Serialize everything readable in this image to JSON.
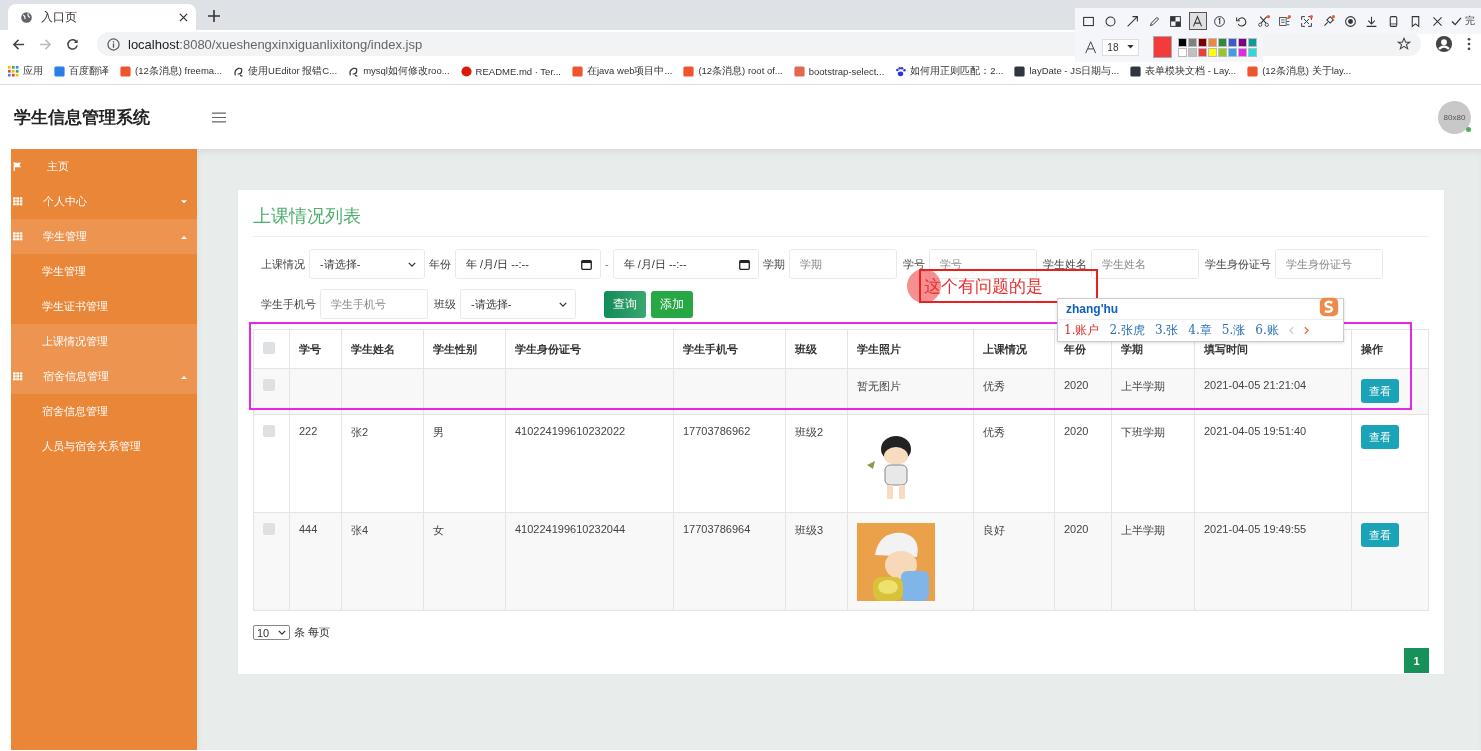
{
  "browser": {
    "tab_title": "入口页",
    "url_host": "localhost",
    "url_rest": ":8080/xueshengxinxiguanlixitong/index.jsp",
    "bookmarks": [
      {
        "label": "应用",
        "kind": "apps"
      },
      {
        "label": "百度翻译",
        "kind": "square",
        "color": "#2a7ee8"
      },
      {
        "label": "(12条消息) freema...",
        "kind": "square",
        "color": "#f0542c"
      },
      {
        "label": "使用UEditor 报错C...",
        "kind": "swirl"
      },
      {
        "label": "mysql如何修改roo...",
        "kind": "swirl"
      },
      {
        "label": "README.md · Ter...",
        "kind": "circle",
        "color": "#d81e06"
      },
      {
        "label": "在java web项目中...",
        "kind": "square",
        "color": "#f0542c"
      },
      {
        "label": "(12条消息) root of...",
        "kind": "square",
        "color": "#f0542c"
      },
      {
        "label": "bootstrap-select...",
        "kind": "square",
        "color": "#e2694f"
      },
      {
        "label": "如何用正则匹配：2...",
        "kind": "paw",
        "color": "#2932e1"
      },
      {
        "label": "layDate - JS日期与...",
        "kind": "square",
        "color": "#2f3640"
      },
      {
        "label": "表单模块文档 - Lay...",
        "kind": "square",
        "color": "#2f3640"
      },
      {
        "label": "(12条消息) 关于lay...",
        "kind": "square",
        "color": "#f0542c"
      }
    ]
  },
  "capture_toolbar": {
    "tools": [
      {
        "kind": "rectangle",
        "selected": false,
        "badge_dot": false
      },
      {
        "kind": "ellipse",
        "selected": false,
        "badge_dot": false
      },
      {
        "kind": "arrow",
        "selected": false,
        "badge_dot": false
      },
      {
        "kind": "pencil",
        "selected": false,
        "badge_dot": false
      },
      {
        "kind": "mosaic",
        "selected": false,
        "badge_dot": false
      },
      {
        "kind": "text",
        "selected": true,
        "badge_dot": false
      },
      {
        "kind": "number",
        "selected": false,
        "badge_dot": false
      },
      {
        "kind": "undo",
        "selected": false,
        "badge_dot": false
      },
      {
        "kind": "cut",
        "selected": false,
        "badge_dot": true
      },
      {
        "kind": "ocr",
        "selected": false,
        "badge_dot": true
      },
      {
        "kind": "capture",
        "selected": false,
        "badge_dot": true
      },
      {
        "kind": "pin",
        "selected": false,
        "badge_dot": true
      },
      {
        "kind": "record",
        "selected": false,
        "badge_dot": false
      },
      {
        "kind": "download",
        "selected": false,
        "badge_dot": false
      },
      {
        "kind": "phone",
        "selected": false,
        "badge_dot": false
      },
      {
        "kind": "bookmark",
        "selected": false,
        "badge_dot": false
      },
      {
        "kind": "close",
        "selected": false,
        "badge_dot": false
      }
    ],
    "done_label": "完",
    "font_size": "18",
    "swatches": [
      {
        "color": "#000000"
      },
      {
        "color": "#808080"
      },
      {
        "color": "#800000"
      },
      {
        "color": "#f0883c"
      },
      {
        "color": "#2e8b3c"
      },
      {
        "color": "#3c5ad0"
      },
      {
        "color": "#800080"
      },
      {
        "color": "#0f9a9a"
      },
      {
        "color": "#ffffff"
      },
      {
        "color": "#c0c0c0"
      },
      {
        "color": "#f03c3c"
      },
      {
        "color": "#ffff00"
      },
      {
        "color": "#96c81e"
      },
      {
        "color": "#3ca0e6"
      },
      {
        "color": "#e628e6"
      },
      {
        "color": "#28dcdc"
      }
    ]
  },
  "app": {
    "title": "学生信息管理系统",
    "avatar_label": "80x80"
  },
  "sidebar": {
    "items": [
      {
        "label": "主页",
        "kind": "flag",
        "selected": false
      },
      {
        "label": "个人中心",
        "kind": "grid",
        "selected": false,
        "expanded": false
      },
      {
        "label": "学生管理",
        "kind": "grid",
        "selected": false,
        "expanded": true,
        "children": [
          {
            "label": "学生管理",
            "selected": false
          },
          {
            "label": "学生证书管理",
            "selected": false
          },
          {
            "label": "上课情况管理",
            "selected": true
          }
        ]
      },
      {
        "label": "宿舍信息管理",
        "kind": "grid",
        "selected": false,
        "expanded": true,
        "children": [
          {
            "label": "宿舍信息管理",
            "selected": false
          },
          {
            "label": "人员与宿舍关系管理",
            "selected": false
          }
        ]
      }
    ]
  },
  "card": {
    "title": "上课情况列表",
    "filter_rows": [
      {
        "fields": [
          {
            "label": "上课情况",
            "kind": "select",
            "value": "-请选择-"
          },
          {
            "label": "年份",
            "kind": "daterange",
            "values": [
              "年 /月/日 --:--",
              "年 /月/日 --:--"
            ],
            "separator": "-"
          },
          {
            "label": "学期",
            "kind": "text",
            "placeholder": "学期"
          },
          {
            "label": "学号",
            "kind": "text",
            "placeholder": "学号"
          },
          {
            "label": "学生姓名",
            "kind": "text",
            "placeholder": "学生姓名"
          },
          {
            "label": "学生身份证号",
            "kind": "text",
            "placeholder": "学生身份证号"
          }
        ]
      },
      {
        "fields": [
          {
            "label": "学生手机号",
            "kind": "text",
            "placeholder": "学生手机号"
          },
          {
            "label": "班级",
            "kind": "select",
            "value": "-请选择-"
          }
        ],
        "buttons": [
          {
            "label": "查询",
            "kind": "search"
          },
          {
            "label": "添加",
            "kind": "add"
          }
        ]
      }
    ],
    "table": {
      "header_checked": false,
      "columns": [
        "学号",
        "学生姓名",
        "学生性别",
        "学生身份证号",
        "学生手机号",
        "班级",
        "学生照片",
        "上课情况",
        "年份",
        "学期",
        "填写时间",
        "操作"
      ],
      "rows": [
        {
          "checked": false,
          "cells": [
            "",
            "",
            "",
            "",
            "",
            ""
          ],
          "photo": {
            "kind": "text",
            "text": "暂无图片"
          },
          "rest": [
            "优秀",
            "2020",
            "上半学期",
            "2021-04-05 21:21:04"
          ],
          "action": "查看"
        },
        {
          "checked": false,
          "cells": [
            "222",
            "张2",
            "男",
            "410224199610232022",
            "17703786962",
            "班级2"
          ],
          "rest": [
            "优秀",
            "2020",
            "下班学期",
            "2021-04-05 19:51:40"
          ],
          "action": "查看"
        },
        {
          "checked": false,
          "cells": [
            "444",
            "张4",
            "女",
            "410224199610232044",
            "17703786964",
            "班级3"
          ],
          "rest": [
            "良好",
            "2020",
            "上半学期",
            "2021-04-05 19:49:55"
          ],
          "action": "查看"
        }
      ]
    },
    "page_size": "10",
    "page_size_suffix": "条 每页",
    "pages": [
      {
        "label": "1",
        "selected": true
      }
    ]
  },
  "annotation": {
    "text": "这个有问题的是",
    "ime": {
      "composition": "zhang'hu",
      "candidates": [
        {
          "label": "1.账户",
          "selected": true
        },
        {
          "label": "2.张虎",
          "selected": false
        },
        {
          "label": "3.张",
          "selected": false
        },
        {
          "label": "4.章",
          "selected": false
        },
        {
          "label": "5.涨",
          "selected": false
        },
        {
          "label": "6.账",
          "selected": false
        }
      ]
    }
  }
}
